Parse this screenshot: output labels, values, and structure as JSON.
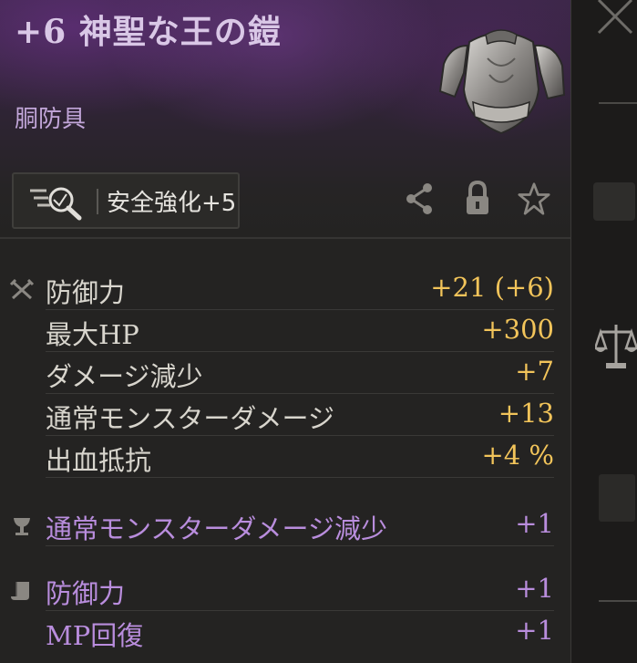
{
  "item": {
    "title": "+6 神聖な王の鎧",
    "type": "胴防具",
    "image": "plate-armor-image"
  },
  "badge": {
    "icon": "magnify-icon",
    "text": "安全強化+5"
  },
  "actions": [
    {
      "name": "share-icon"
    },
    {
      "name": "lock-icon"
    },
    {
      "name": "star-icon"
    }
  ],
  "stats": [
    {
      "icon": "crossed-swords-icon",
      "label": "防御力",
      "value": "+21 (+6)"
    },
    {
      "label": "最大HP",
      "value": "+300"
    },
    {
      "label": "ダメージ減少",
      "value": "+7"
    },
    {
      "label": "通常モンスターダメージ",
      "value": "+13"
    },
    {
      "label": "出血抵抗",
      "value": "+4 %"
    }
  ],
  "bonus_stats": [
    {
      "icon": "goblet-icon",
      "label": "通常モンスターダメージ減少",
      "value": "+1"
    },
    {
      "icon": "scroll-icon",
      "label": "防御力",
      "value": "+1"
    },
    {
      "label": "MP回復",
      "value": "+1"
    }
  ],
  "colors": {
    "accent_gold": "#f2c45a",
    "accent_purple": "#b98ddd",
    "header_purple": "#3c2748"
  },
  "side_icons": [
    "close-icon",
    "scales-icon"
  ]
}
